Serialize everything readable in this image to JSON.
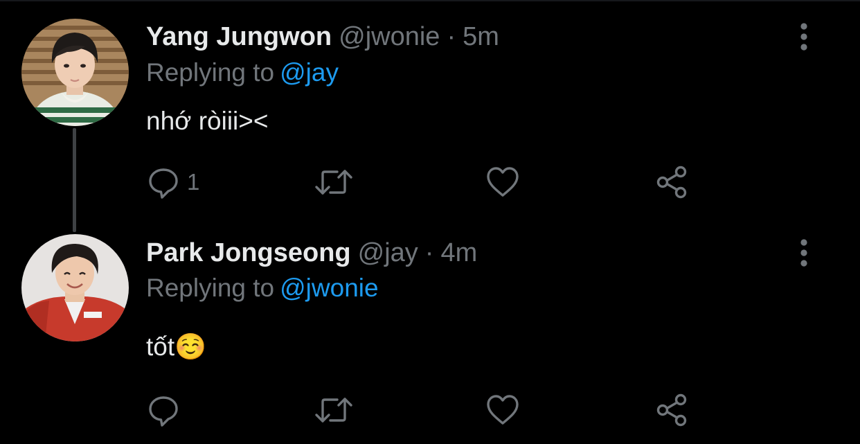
{
  "theme": {
    "background": "#000000",
    "primary_text": "#e7e9ea",
    "secondary_text": "#71767b",
    "accent": "#1d9bf0",
    "thread_line": "#3e4144"
  },
  "tweets": [
    {
      "display_name": "Yang Jungwon",
      "handle": "@jwonie",
      "separator": "·",
      "time": "5m",
      "replying_prefix": "Replying to",
      "replying_to": "@jay",
      "text": "nhớ ròiii><",
      "avatar_icon": "profile-photo",
      "actions": {
        "reply_count": "1",
        "retweet_count": "",
        "like_count": ""
      }
    },
    {
      "display_name": "Park Jongseong",
      "handle": "@jay",
      "separator": "·",
      "time": "4m",
      "replying_prefix": "Replying to",
      "replying_to": "@jwonie",
      "text": "tốt☺️",
      "avatar_icon": "profile-photo",
      "actions": {
        "reply_count": "",
        "retweet_count": "",
        "like_count": ""
      }
    }
  ],
  "icons": {
    "more": "more-vertical-icon",
    "reply": "reply-bubble-icon",
    "retweet": "retweet-icon",
    "like": "heart-icon",
    "share": "share-icon"
  }
}
